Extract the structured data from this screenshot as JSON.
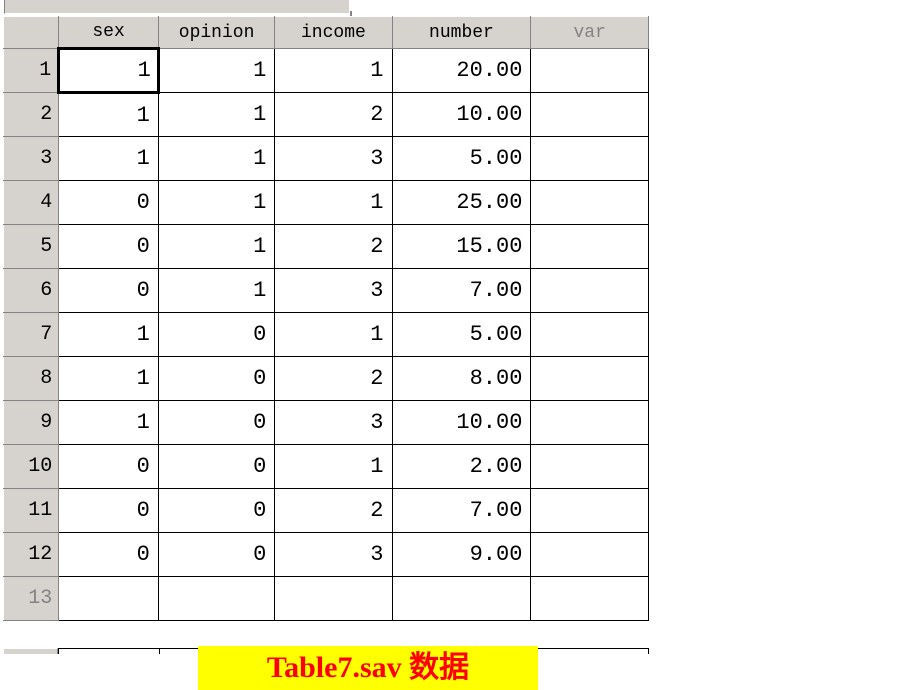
{
  "columns": [
    "sex",
    "opinion",
    "income",
    "number",
    "var"
  ],
  "rows": [
    {
      "n": "1",
      "sex": "1",
      "opinion": "1",
      "income": "1",
      "number": "20.00"
    },
    {
      "n": "2",
      "sex": "1",
      "opinion": "1",
      "income": "2",
      "number": "10.00"
    },
    {
      "n": "3",
      "sex": "1",
      "opinion": "1",
      "income": "3",
      "number": "5.00"
    },
    {
      "n": "4",
      "sex": "0",
      "opinion": "1",
      "income": "1",
      "number": "25.00"
    },
    {
      "n": "5",
      "sex": "0",
      "opinion": "1",
      "income": "2",
      "number": "15.00"
    },
    {
      "n": "6",
      "sex": "0",
      "opinion": "1",
      "income": "3",
      "number": "7.00"
    },
    {
      "n": "7",
      "sex": "1",
      "opinion": "0",
      "income": "1",
      "number": "5.00"
    },
    {
      "n": "8",
      "sex": "1",
      "opinion": "0",
      "income": "2",
      "number": "8.00"
    },
    {
      "n": "9",
      "sex": "1",
      "opinion": "0",
      "income": "3",
      "number": "10.00"
    },
    {
      "n": "10",
      "sex": "0",
      "opinion": "0",
      "income": "1",
      "number": "2.00"
    },
    {
      "n": "11",
      "sex": "0",
      "opinion": "0",
      "income": "2",
      "number": "7.00"
    },
    {
      "n": "12",
      "sex": "0",
      "opinion": "0",
      "income": "3",
      "number": "9.00"
    }
  ],
  "empty_row": "13",
  "caption": "Table7.sav 数据"
}
